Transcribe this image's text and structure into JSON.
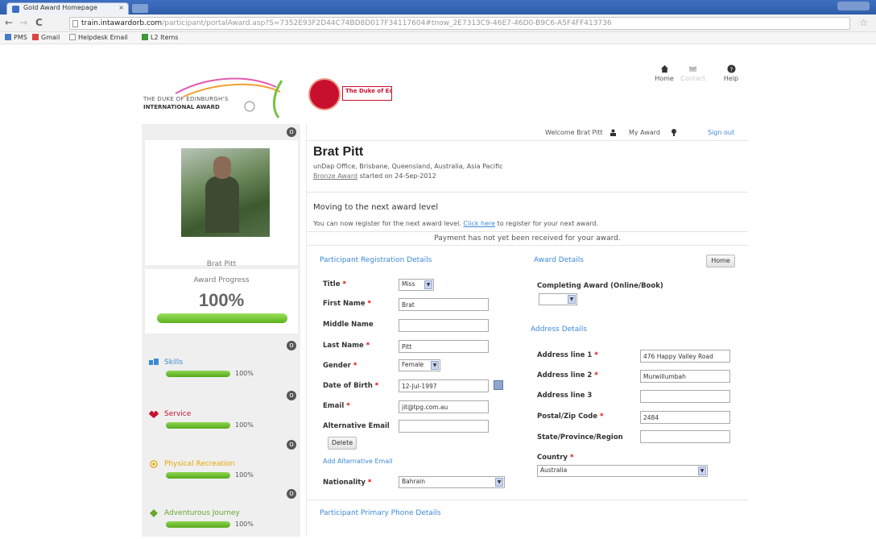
{
  "browser": {
    "tab_title": "Gold Award Homepage",
    "tab_close": "×",
    "url_host": "train.intawardorb.com",
    "url_path": "/participant/portalAward.asp?S=7352E93F2D44C74BD8D017F34117604#tnow_2E7313C9-46E7-46D0-B9C6-A5F4FF413736",
    "back": "←",
    "forward": "→",
    "reload": "C",
    "star": "☆",
    "bookmarks": [
      "PMS",
      "Gmail",
      "Helpdesk Email",
      "L2 Items"
    ]
  },
  "header": {
    "logo_line1": "THE DUKE OF EDINBURGH'S",
    "logo_line2": "INTERNATIONAL AWARD",
    "partner_banner": "The Duke of Ed",
    "nav": [
      {
        "label": "Home"
      },
      {
        "label": "Contact"
      },
      {
        "label": "Help"
      }
    ]
  },
  "sidebar": {
    "collapse_glyph": "o",
    "profile_name": "Brat Pitt",
    "progress_label": "Award Progress",
    "progress_value": "100%",
    "progress_fraction": 1.0,
    "sections": [
      {
        "name": "Skills",
        "percent": "100%",
        "fraction": 1.0,
        "color": "#3d8ad6",
        "icon": "skills-icon"
      },
      {
        "name": "Service",
        "percent": "100%",
        "fraction": 1.0,
        "color": "#c8102e",
        "icon": "service-icon"
      },
      {
        "name": "Physical Recreation",
        "percent": "100%",
        "fraction": 1.0,
        "color": "#e6a700",
        "icon": "physical-recreation-icon"
      },
      {
        "name": "Adventurous Journey",
        "percent": "100%",
        "fraction": 1.0,
        "color": "#6aa52f",
        "icon": "adventurous-journey-icon"
      }
    ]
  },
  "userbar": {
    "welcome": "Welcome Brat Pitt",
    "my_award": "My Award",
    "signout": "Sign out"
  },
  "participant": {
    "name": "Brat Pitt",
    "location": "unDap Office, Brisbane, Queensland, Australia, Asia Pacific",
    "award_link": "Bronze Award",
    "started": "started on 24-Sep-2012"
  },
  "next_level": {
    "title": "Moving to the next award level",
    "text_before": "You can now register for the next award level.",
    "link": "Click here",
    "text_after": "to register for your next award."
  },
  "payment_notice": "Payment has not yet been received for your award.",
  "registration": {
    "section_title": "Participant Registration Details",
    "title_label": "Title",
    "title_value": "Miss",
    "first_name_label": "First Name",
    "first_name_value": "Brat",
    "middle_name_label": "Middle Name",
    "middle_name_value": "",
    "last_name_label": "Last Name",
    "last_name_value": "Pitt",
    "gender_label": "Gender",
    "gender_value": "Female",
    "dob_label": "Date of Birth",
    "dob_value": "12-Jul-1997",
    "email_label": "Email",
    "email_value": "jit@tpg.com.au",
    "alt_email_label": "Alternative Email",
    "alt_email_value": "",
    "delete_label": "Delete",
    "add_alt_label": "Add Alternative Email",
    "nationality_label": "Nationality",
    "nationality_value": "Bahrain",
    "required_mark": "*"
  },
  "award_details": {
    "section_title": "Award Details",
    "home_button": "Home",
    "completing_label": "Completing Award (Online/Book)",
    "completing_value": ""
  },
  "address": {
    "section_title": "Address Details",
    "line1_label": "Address line 1",
    "line1_value": "476 Happy Valley Road",
    "line2_label": "Address line 2",
    "line2_value": "Murwillumbah",
    "line3_label": "Address line 3",
    "line3_value": "",
    "postal_label": "Postal/Zip Code",
    "postal_value": "2484",
    "state_label": "State/Province/Region",
    "state_value": "",
    "country_label": "Country",
    "country_value": "Australia"
  },
  "phone": {
    "section_title": "Participant Primary Phone Details"
  }
}
